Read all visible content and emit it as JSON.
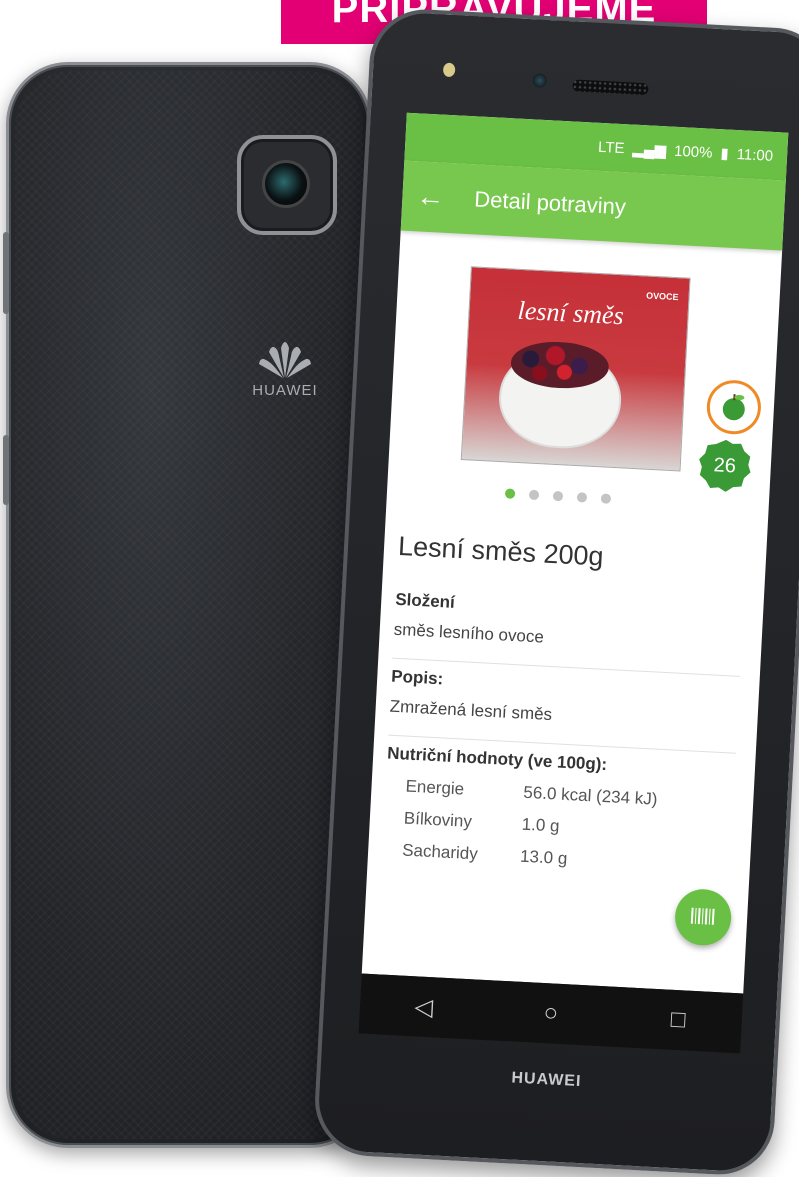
{
  "banner": {
    "text": "PŘIPRAVUJEME"
  },
  "back_phone": {
    "brand": "HUAWEI"
  },
  "front_phone": {
    "brand": "HUAWEI"
  },
  "statusbar": {
    "network": "LTE",
    "battery": "100%",
    "time": "11:00"
  },
  "appbar": {
    "title": "Detail potraviny"
  },
  "product": {
    "pack_text": "lesní směs",
    "pack_tag": "OVOCE",
    "score": "26",
    "name": "Lesní směs 200g",
    "sections": {
      "composition_title": "Složení",
      "composition_text": "směs lesního ovoce",
      "description_title": "Popis:",
      "description_text": "Zmražená lesní směs",
      "nutrition_title": "Nutriční hodnoty (ve 100g):"
    },
    "nutrition": [
      {
        "label": "Energie",
        "value": "56.0 kcal (234 kJ)"
      },
      {
        "label": "Bílkoviny",
        "value": "1.0 g"
      },
      {
        "label": "Sacharidy",
        "value": "13.0 g"
      }
    ]
  },
  "carousel": {
    "count": 5,
    "active_index": 0
  },
  "icons": {
    "back": "back-arrow-icon",
    "barcode": "barcode-icon",
    "nav_back": "triangle-back-icon",
    "nav_home": "circle-home-icon",
    "nav_recent": "square-recent-icon"
  },
  "colors": {
    "banner": "#e20074",
    "statusbar": "#6abf45",
    "appbar": "#78c84f",
    "accent": "#6abf45",
    "score_badge": "#3a9a35"
  }
}
